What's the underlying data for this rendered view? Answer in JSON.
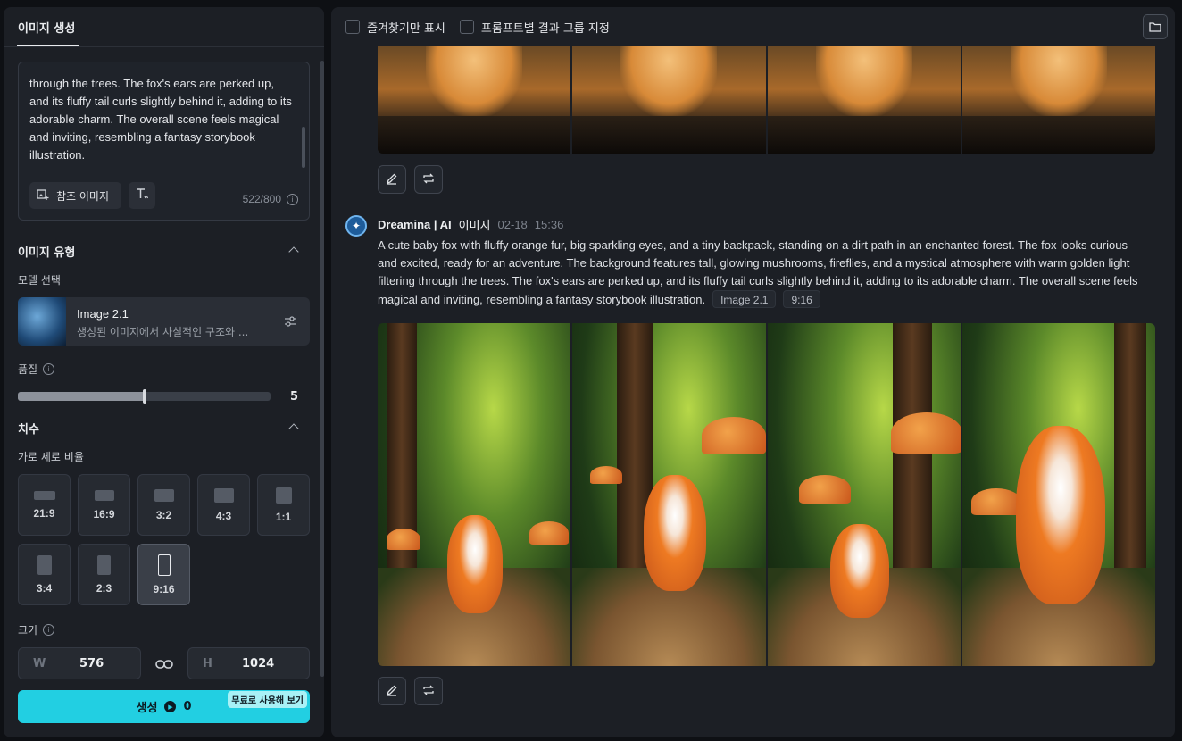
{
  "sidebar": {
    "tab_label": "이미지 생성",
    "prompt": {
      "text": "through the trees. The fox's ears are perked up, and its fluffy tail curls slightly behind it, adding to its adorable charm. The overall scene feels magical and inviting, resembling a fantasy storybook illustration.",
      "ref_image_label": "참조 이미지",
      "counter": "522/800"
    },
    "image_type": {
      "heading": "이미지 유형",
      "model_label": "모델 선택",
      "model_name": "Image 2.1",
      "model_desc": "생성된 이미지에서 사실적인 구조와 ...",
      "quality_label": "품질",
      "quality_value": "5",
      "quality_fraction": 0.5
    },
    "dimensions": {
      "heading": "치수",
      "ratio_label": "가로 세로 비율",
      "ratios": [
        "21:9",
        "16:9",
        "3:2",
        "4:3",
        "1:1",
        "3:4",
        "2:3",
        "9:16"
      ],
      "selected_ratio": "9:16",
      "size_label": "크기",
      "width_key": "W",
      "width_value": "576",
      "height_key": "H",
      "height_value": "1024"
    },
    "generate": {
      "label": "생성",
      "credits": "0",
      "free_badge": "무료로 사용해 보기"
    }
  },
  "main": {
    "toolbar": {
      "favorites_only": "즐겨찾기만 표시",
      "group_by_prompt": "프롬프트별 결과 그룹 지정"
    },
    "entry": {
      "author": "Dreamina | AI",
      "kind": "이미지",
      "date": "02-18",
      "time": "15:36",
      "prompt": "A cute baby fox with fluffy orange fur, big sparkling eyes, and a tiny backpack, standing on a dirt path in an enchanted forest. The fox looks curious and excited, ready for an adventure. The background features tall, glowing mushrooms, fireflies, and a mystical atmosphere with warm golden light filtering through the trees. The fox's ears are perked up, and its fluffy tail curls slightly behind it, adding to its adorable charm. The overall scene feels magical and inviting, resembling a fantasy storybook illustration.",
      "tag_model": "Image 2.1",
      "tag_ratio": "9:16"
    }
  },
  "colors": {
    "accent": "#22cfe2",
    "panel": "#1c1f25",
    "background": "#0e1014"
  }
}
